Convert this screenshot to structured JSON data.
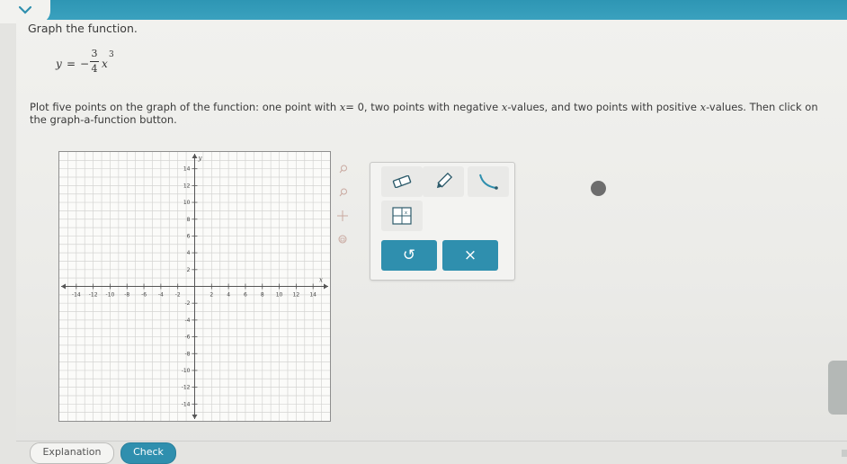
{
  "question": {
    "title": "Graph the function.",
    "equation": {
      "lhs": "y",
      "equals": "=",
      "sign": "−",
      "numerator": "3",
      "denominator": "4",
      "variable": "x",
      "exponent": "3"
    },
    "instruction": {
      "part1": "Plot five points on the graph of the function: one point with",
      "x_var": "x",
      "eq_zero": "= 0",
      "part2": ", two points with negative",
      "x_var2": "x",
      "part3": "-values, and two points with positive",
      "x_var3": "x",
      "part4": "-values. Then click on the graph-a-function button."
    }
  },
  "graph": {
    "x_axis_label": "x",
    "y_axis_label": "y",
    "x_range": [
      -16,
      16
    ],
    "y_range": [
      -16,
      16
    ],
    "grid_step": 1,
    "x_tick_labels": [
      "-14",
      "-12",
      "-10",
      "-8",
      "-6",
      "-4",
      "-2",
      "2",
      "4",
      "6",
      "8",
      "10",
      "12",
      "14"
    ],
    "y_tick_labels": [
      "14",
      "12",
      "10",
      "8",
      "6",
      "4",
      "2",
      "-2",
      "-4",
      "-6",
      "-8",
      "-10",
      "-12",
      "-14"
    ],
    "side_tools": [
      "zoom-in-icon",
      "zoom-out-icon",
      "pan-icon",
      "home-icon"
    ]
  },
  "tools": {
    "buttons": [
      "eraser-icon",
      "pencil-icon",
      "curve-icon",
      "graph-function-icon"
    ],
    "undo_symbol": "↺",
    "clear_symbol": "×"
  },
  "footer": {
    "explanation_label": "Explanation",
    "check_label": "Check"
  },
  "colors": {
    "accent": "#2f8fae",
    "topbar": "#3399b7"
  }
}
